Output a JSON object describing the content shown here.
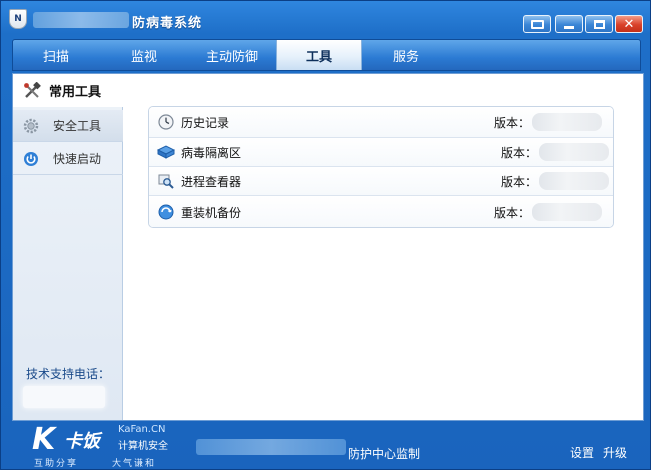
{
  "window": {
    "title": "防病毒系统",
    "logo_text": "N"
  },
  "tabs": [
    {
      "label": "扫描",
      "active": false
    },
    {
      "label": "监视",
      "active": false
    },
    {
      "label": "主动防御",
      "active": false
    },
    {
      "label": "工具",
      "active": true
    },
    {
      "label": "服务",
      "active": false
    }
  ],
  "sidebar": {
    "header_label": "常用工具",
    "items": [
      {
        "label": "安全工具",
        "icon": "gear-icon"
      },
      {
        "label": "快速启动",
        "icon": "power-icon"
      }
    ],
    "support_label": "技术支持电话："
  },
  "tools": [
    {
      "name": "历史记录",
      "icon": "clock-icon",
      "version_label": "版本："
    },
    {
      "name": "病毒隔离区",
      "icon": "quarantine-box-icon",
      "version_label": "版本："
    },
    {
      "name": "进程查看器",
      "icon": "magnifier-icon",
      "version_label": "版本："
    },
    {
      "name": "重装机备份",
      "icon": "backup-disc-icon",
      "version_label": "版本："
    }
  ],
  "footer": {
    "brand_k": "K",
    "brand_cn": "卡饭",
    "brand_domain": "KaFan.CN",
    "brand_sub": "计算机安全",
    "slogan_left": "互助分享",
    "slogan_right": "大气谦和",
    "center_text": "防护中心监制",
    "settings_label": "设置",
    "upgrade_label": "升级"
  },
  "colors": {
    "accent": "#1f6fc9",
    "close_button": "#d9412a"
  }
}
